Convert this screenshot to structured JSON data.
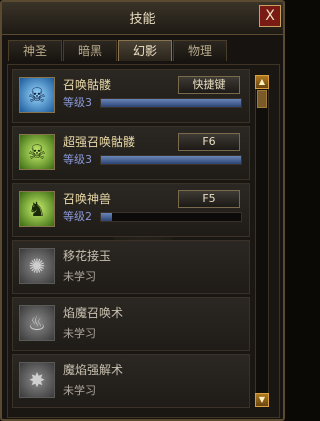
{
  "window": {
    "title": "技能",
    "close_label": "X"
  },
  "tabs": [
    {
      "label": "神圣"
    },
    {
      "label": "暗黑"
    },
    {
      "label": "幻影"
    },
    {
      "label": "物理"
    }
  ],
  "active_tab": 2,
  "skills": [
    {
      "name": "召唤骷髅",
      "level": "等级3",
      "progress": 1.0,
      "hotkey": "快捷键",
      "icon": "skull-icon",
      "learned": true
    },
    {
      "name": "超强召唤骷髅",
      "level": "等级3",
      "progress": 1.0,
      "hotkey": "F6",
      "icon": "green-skull-icon",
      "learned": true
    },
    {
      "name": "召唤神兽",
      "level": "等级2",
      "progress": 0.08,
      "hotkey": "F5",
      "icon": "beast-icon",
      "learned": true
    },
    {
      "name": "移花接玉",
      "status": "未学习",
      "icon": "swirl-icon",
      "learned": false
    },
    {
      "name": "焰魔召唤术",
      "status": "未学习",
      "icon": "flame-demon-icon",
      "learned": false
    },
    {
      "name": "魔焰强解术",
      "status": "未学习",
      "icon": "burst-icon",
      "learned": false
    }
  ],
  "colors": {
    "frame": "#5a4a30",
    "title_text": "#e8dcc0",
    "level_text": "#8a98d8",
    "bar_fill": "#4a6aa0",
    "close_button": "#7a1a14"
  }
}
